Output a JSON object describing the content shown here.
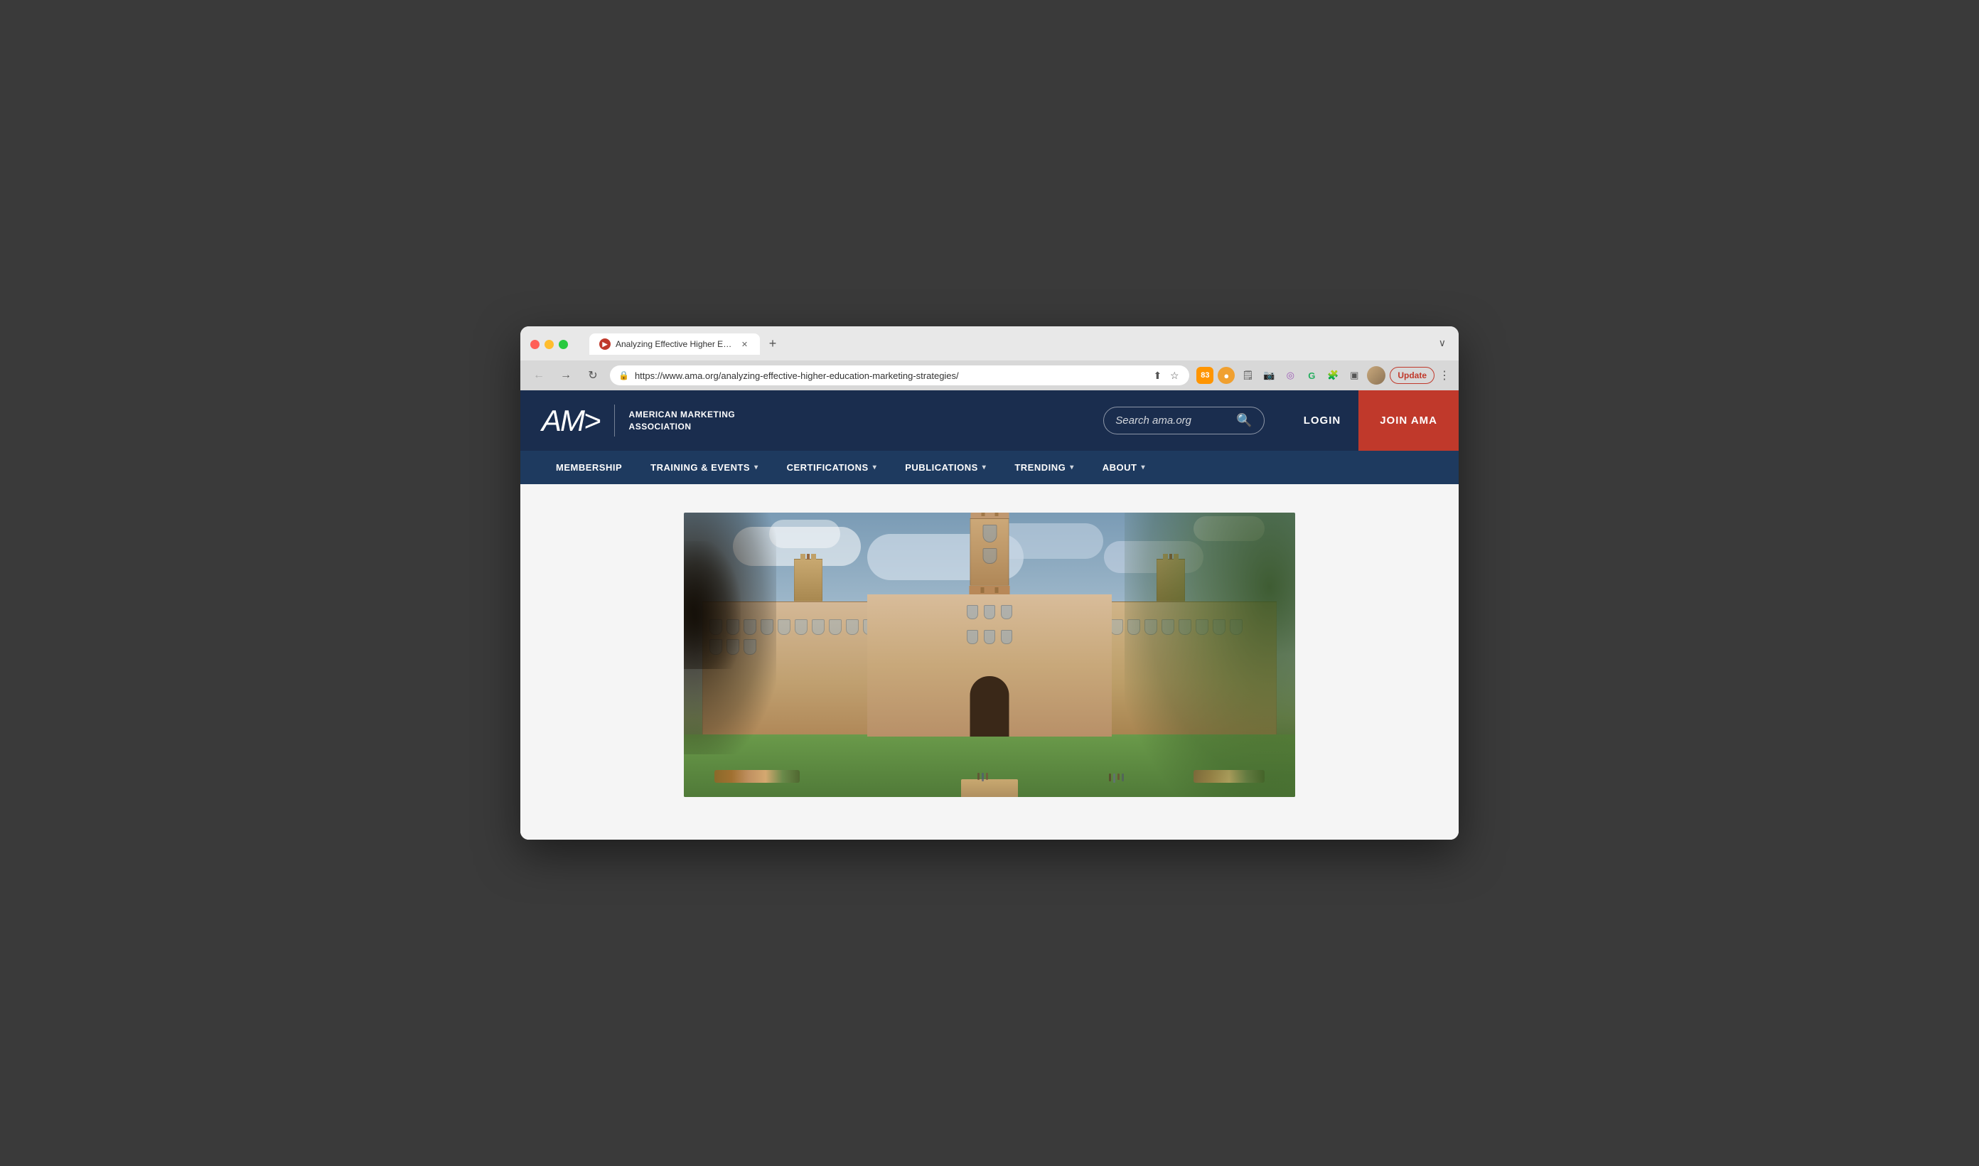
{
  "browser": {
    "tab": {
      "favicon": "▶",
      "title": "Analyzing Effective Higher Edu...",
      "close": "✕"
    },
    "new_tab": "+",
    "expander": "∨",
    "url": "https://www.ama.org/analyzing-effective-higher-education-marketing-strategies/",
    "nav": {
      "back": "←",
      "forward": "→",
      "reload": "↻"
    },
    "update_btn": "Update"
  },
  "header": {
    "logo": {
      "icon": "AM>",
      "line1": "AMERICAN MARKETING",
      "line2": "ASSOCIATION"
    },
    "search": {
      "placeholder": "Search ama.org"
    },
    "login": "LOGIN",
    "join": "JOIN AMA"
  },
  "nav": {
    "items": [
      {
        "label": "MEMBERSHIP",
        "has_dropdown": false
      },
      {
        "label": "TRAINING & EVENTS",
        "has_dropdown": true
      },
      {
        "label": "CERTIFICATIONS",
        "has_dropdown": true
      },
      {
        "label": "PUBLICATIONS",
        "has_dropdown": true
      },
      {
        "label": "TRENDING",
        "has_dropdown": true
      },
      {
        "label": "ABOUT",
        "has_dropdown": true
      }
    ]
  },
  "hero": {
    "alt": "University building - higher education marketing"
  }
}
